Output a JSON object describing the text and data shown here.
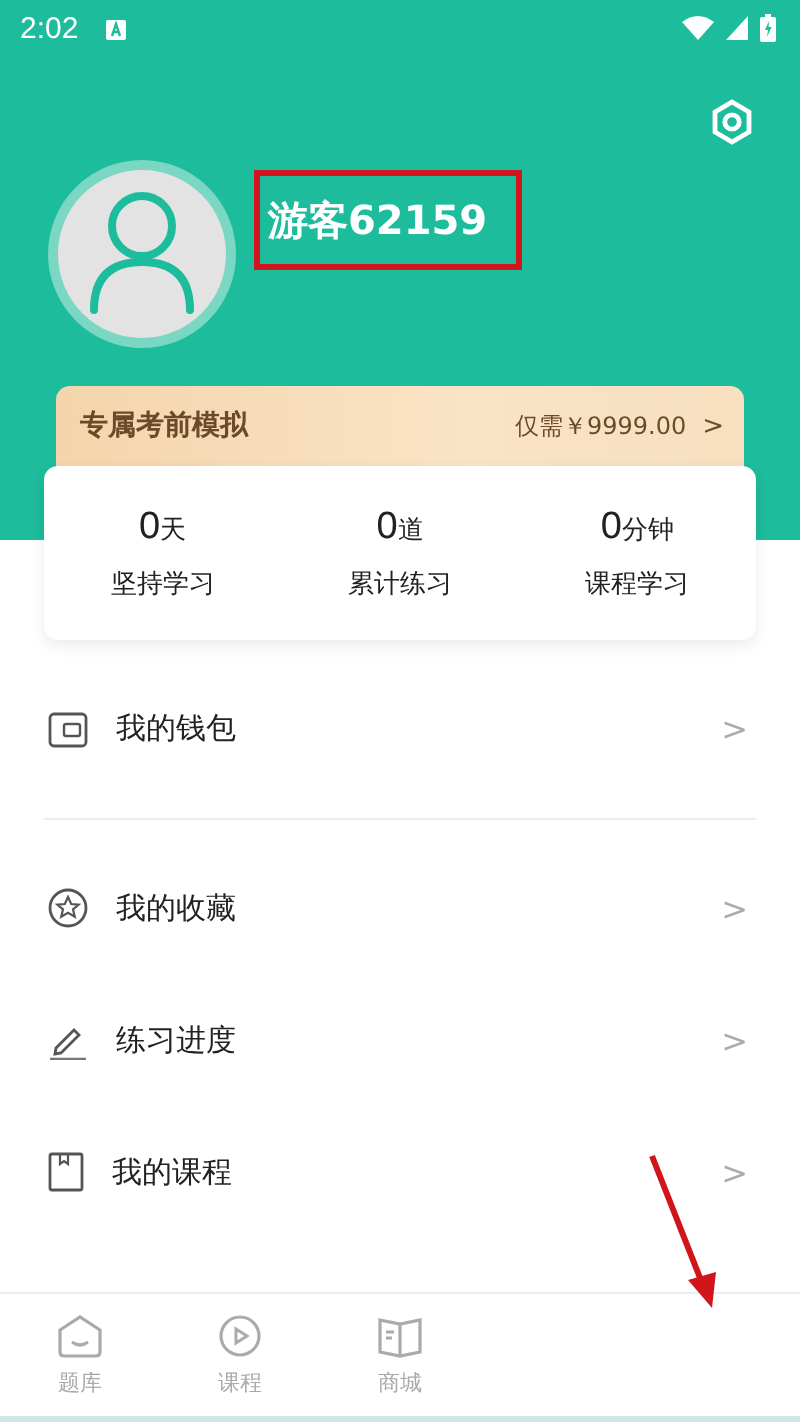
{
  "status_bar": {
    "time": "2:02"
  },
  "profile": {
    "username": "游客62159"
  },
  "promo": {
    "title": "专属考前模拟",
    "price": "仅需￥9999.00",
    "chevron": ">"
  },
  "stats": [
    {
      "value": "0",
      "unit": "天",
      "label": "坚持学习"
    },
    {
      "value": "0",
      "unit": "道",
      "label": "累计练习"
    },
    {
      "value": "0",
      "unit": "分钟",
      "label": "课程学习"
    }
  ],
  "menu": [
    {
      "label": "我的钱包",
      "chevron": ">",
      "divider_after": true
    },
    {
      "label": "我的收藏",
      "chevron": ">",
      "divider_after": false
    },
    {
      "label": "练习进度",
      "chevron": ">",
      "divider_after": false
    },
    {
      "label": "我的课程",
      "chevron": ">",
      "divider_after": false
    }
  ],
  "bottom_nav": [
    {
      "label": "题库",
      "selected": false
    },
    {
      "label": "课程",
      "selected": false
    },
    {
      "label": "商城",
      "selected": false
    }
  ]
}
